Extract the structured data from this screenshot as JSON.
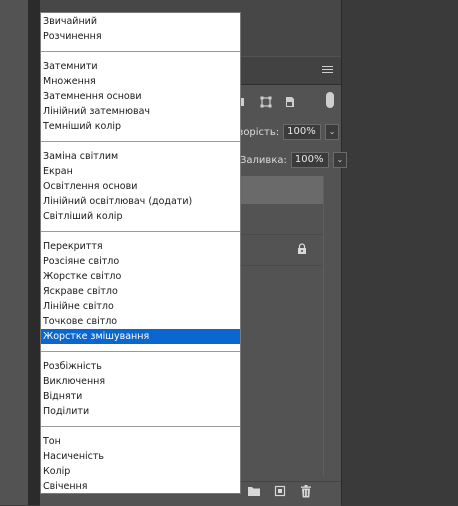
{
  "blend_menu": {
    "groups": [
      [
        "Звичайний",
        "Розчинення"
      ],
      [
        "Затемнити",
        "Множення",
        "Затемнення основи",
        "Лінійний затемнювач",
        "Темніший колір"
      ],
      [
        "Заміна світлим",
        "Екран",
        "Освітлення основи",
        "Лінійний освітлювач (додати)",
        "Світліший колір"
      ],
      [
        "Перекриття",
        "Розсіяне світло",
        "Жорстке світло",
        "Яскраве світло",
        "Лінійне світло",
        "Точкове світло",
        "Жорстке змішування"
      ],
      [
        "Розбіжність",
        "Виключення",
        "Відняти",
        "Поділити"
      ],
      [
        "Тон",
        "Насиченість",
        "Колір",
        "Свічення"
      ]
    ],
    "selected": "Жорстке змішування"
  },
  "layers_panel": {
    "opacity_label": "зорість:",
    "opacity_value": "100%",
    "fill_label": "Заливка:",
    "fill_value": "100%"
  },
  "colors": {
    "selection": "#0a67d0",
    "panel_bg": "#535353"
  }
}
